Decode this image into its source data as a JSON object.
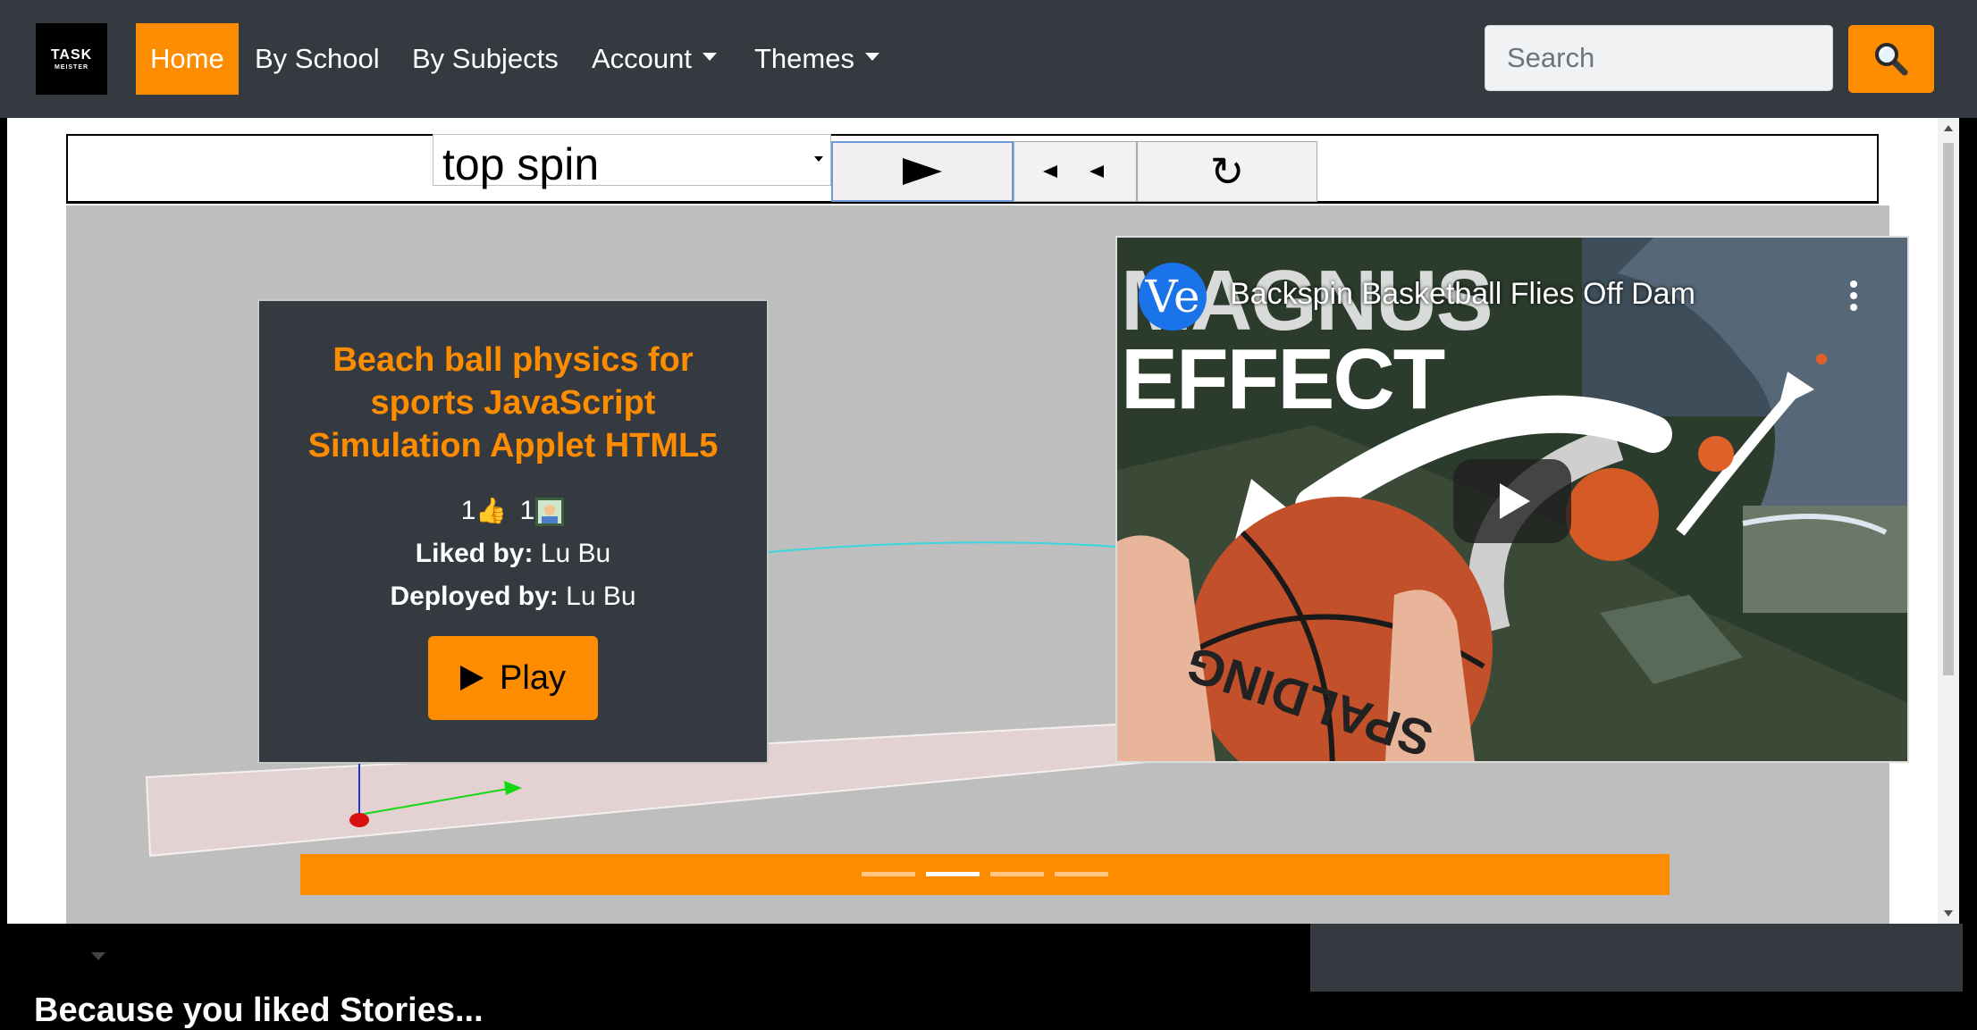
{
  "navbar": {
    "logo": {
      "line1": "TASK",
      "line2": "MEISTER"
    },
    "items": [
      {
        "label": "Home",
        "active": true
      },
      {
        "label": "By School",
        "active": false
      },
      {
        "label": "By Subjects",
        "active": false
      },
      {
        "label": "Account",
        "active": false,
        "dropdown": true
      },
      {
        "label": "Themes",
        "active": false,
        "dropdown": true
      }
    ],
    "search": {
      "placeholder": "Search",
      "value": "",
      "button_icon": "magnifier-icon"
    }
  },
  "simulation": {
    "spin_select": {
      "value": "top spin"
    },
    "controls": [
      {
        "name": "play",
        "icon": "play-triangle"
      },
      {
        "name": "step",
        "icon": "step-back-arrows",
        "label": "◂ ◂"
      },
      {
        "name": "reset",
        "icon": "reload",
        "label": "↻"
      }
    ]
  },
  "card": {
    "title": "Beach ball physics for sports JavaScript Simulation Applet HTML5",
    "likes_count": "1",
    "deploy_count": "1",
    "liked_by_label": "Liked by:",
    "liked_by_value": " Lu Bu",
    "deployed_by_label": "Deployed by:",
    "deployed_by_value": " Lu Bu",
    "play_label": "Play"
  },
  "video": {
    "channel_initials": "Ve",
    "title": "Backspin Basketball Flies Off Dam",
    "overlay_line1": "MAGNUS",
    "overlay_line2": "EFFECT",
    "ball_brand_text": "SPALDING"
  },
  "carousel": {
    "slide_count": 4,
    "active_index": 1
  },
  "section": {
    "heading": "Because you liked Stories..."
  },
  "colors": {
    "accent": "#fd8c00",
    "navbar": "#343a40",
    "canvas_bg": "#bebebe"
  }
}
